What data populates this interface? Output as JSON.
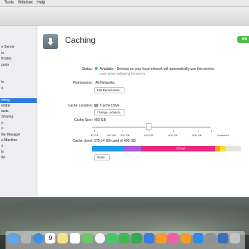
{
  "menubar": {
    "items": [
      "Tools",
      "Window",
      "Help"
    ]
  },
  "sidebar": {
    "items": [
      {
        "label": "e Server"
      },
      {
        "label": "ts"
      },
      {
        "label": "ficates"
      },
      {
        "label": "ports"
      },
      {
        "label": "ts"
      },
      {
        "label": "s"
      },
      {
        "label": "ching",
        "selected": true
      },
      {
        "label": "endar"
      },
      {
        "label": "tacts"
      },
      {
        "label": "Sharing"
      },
      {
        "label": "e"
      },
      {
        "label": "s"
      },
      {
        "label": "file Manager"
      },
      {
        "label": "e Machine"
      },
      {
        "label": "s"
      },
      {
        "label": "ki"
      },
      {
        "label": "ite"
      }
    ]
  },
  "service": {
    "title": "Caching",
    "toggle": "ON"
  },
  "status": {
    "label": "Status:",
    "value": "Available - Devices on your local network will automatically use this service",
    "link": "Learn about configuring this service"
  },
  "permissions": {
    "label": "Permissions:",
    "value": "All Networks",
    "button": "Edit Permissions..."
  },
  "cache_location": {
    "label": "Cache Location:",
    "value": "Cache Drive",
    "button": "Change Location..."
  },
  "cache_size": {
    "label": "Cache Size:",
    "value": "400 GB",
    "fraction": 0.47,
    "ticks": [
      "50 GB",
      "100 GB",
      "200 GB",
      "300 GB",
      "400 GB",
      "500 GB",
      "Unlimited"
    ]
  },
  "cache_used": {
    "label": "Cache Used:",
    "value": "375.14 GB used of 400 GB",
    "icloud_label": "iCloud",
    "button": "Reset...",
    "segments": [
      {
        "name": "blue",
        "color": "#1e9ae8",
        "fraction": 0.21
      },
      {
        "name": "purple",
        "color": "#a85bd3",
        "fraction": 0.12
      },
      {
        "name": "magenta",
        "color": "#e8287a",
        "fraction": 0.5
      },
      {
        "name": "orange",
        "color": "#f5a41d",
        "fraction": 0.03
      },
      {
        "name": "yellow",
        "color": "#f3e32a",
        "fraction": 0.04
      },
      {
        "name": "free",
        "color": "#e4e4e4",
        "fraction": 0.1
      }
    ]
  },
  "dock": {
    "calendar_day": "9",
    "icons": [
      "finder-icon",
      "launchpad-icon",
      "safari-icon",
      "calendar-icon",
      "notes-icon",
      "reminders-icon",
      "maps-icon",
      "photos-icon",
      "messages-icon",
      "facetime-icon",
      "numbers-icon",
      "keynote-icon",
      "pages-icon",
      "itunes-icon",
      "ibooks-icon",
      "app-store-icon",
      "system-preferences-icon",
      "server-icon",
      "trash-icon"
    ]
  }
}
